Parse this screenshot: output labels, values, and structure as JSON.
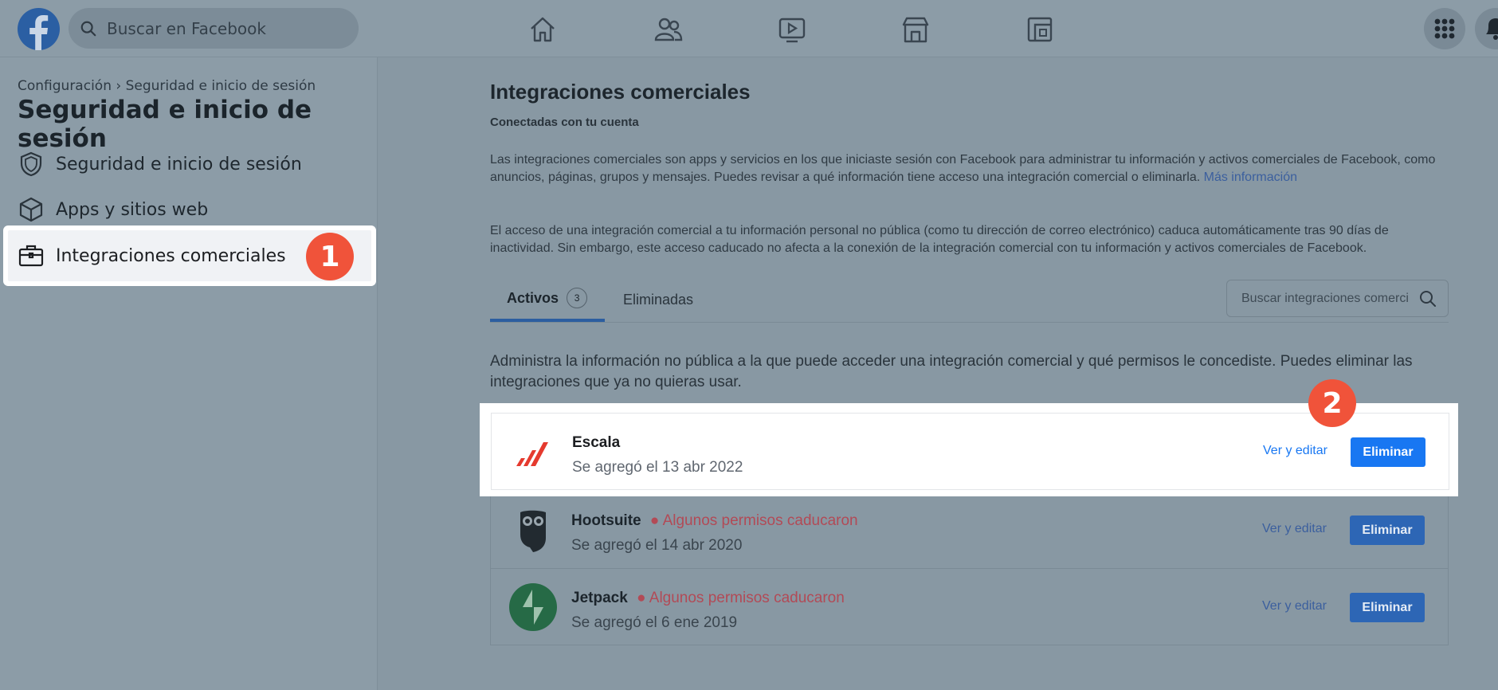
{
  "topbar": {
    "search_placeholder": "Buscar en Facebook",
    "nav_icons": [
      "home-icon",
      "friends-icon",
      "watch-icon",
      "marketplace-icon",
      "gaming-icon"
    ]
  },
  "sidebar": {
    "breadcrumb": "Configuración › Seguridad e inicio de sesión",
    "title": "Seguridad e inicio de sesión",
    "items": [
      {
        "label": "Seguridad e inicio de sesión",
        "icon": "shield-icon"
      },
      {
        "label": "Apps y sitios web",
        "icon": "cube-icon"
      },
      {
        "label": "Integraciones comerciales",
        "icon": "briefcase-icon",
        "active": true
      }
    ]
  },
  "annotations": {
    "step1": "1",
    "step2": "2",
    "color": "#f0533a"
  },
  "main": {
    "title": "Integraciones comerciales",
    "subtitle": "Conectadas con tu cuenta",
    "para1": "Las integraciones comerciales son apps y servicios en los que iniciaste sesión con Facebook para administrar tu información y activos comerciales de Facebook, como anuncios, páginas, grupos y mensajes. Puedes revisar a qué información tiene acceso una integración comercial o eliminarla.",
    "para1_link": "Más información",
    "para2": "El acceso de una integración comercial a tu información personal no pública (como tu dirección de correo electrónico) caduca automáticamente tras 90 días de inactividad. Sin embargo, este acceso caducado no afecta a la conexión de la integración comercial con tu información y activos comerciales de Facebook.",
    "tabs": {
      "active_label": "Activos",
      "active_count": "3",
      "removed_label": "Eliminadas"
    },
    "search_placeholder": "Buscar integraciones comerciales",
    "manage_text": "Administra la información no pública a la que puede acceder una integración comercial y qué permisos le concediste. Puedes eliminar las integraciones que ya no quieras usar.",
    "integrations": [
      {
        "name": "Escala",
        "warning": "",
        "added": "Se agregó el 13 abr 2022",
        "edit": "Ver y editar",
        "remove": "Eliminar"
      },
      {
        "name": "Hootsuite",
        "warning": "● Algunos permisos caducaron",
        "added": "Se agregó el 14 abr 2020",
        "edit": "Ver y editar",
        "remove": "Eliminar"
      },
      {
        "name": "Jetpack",
        "warning": "● Algunos permisos caducaron",
        "added": "Se agregó el 6 ene 2019",
        "edit": "Ver y editar",
        "remove": "Eliminar"
      }
    ]
  },
  "colors": {
    "facebook_blue": "#1877f2",
    "overlay": "#8898a3",
    "warning": "#b24a56"
  }
}
